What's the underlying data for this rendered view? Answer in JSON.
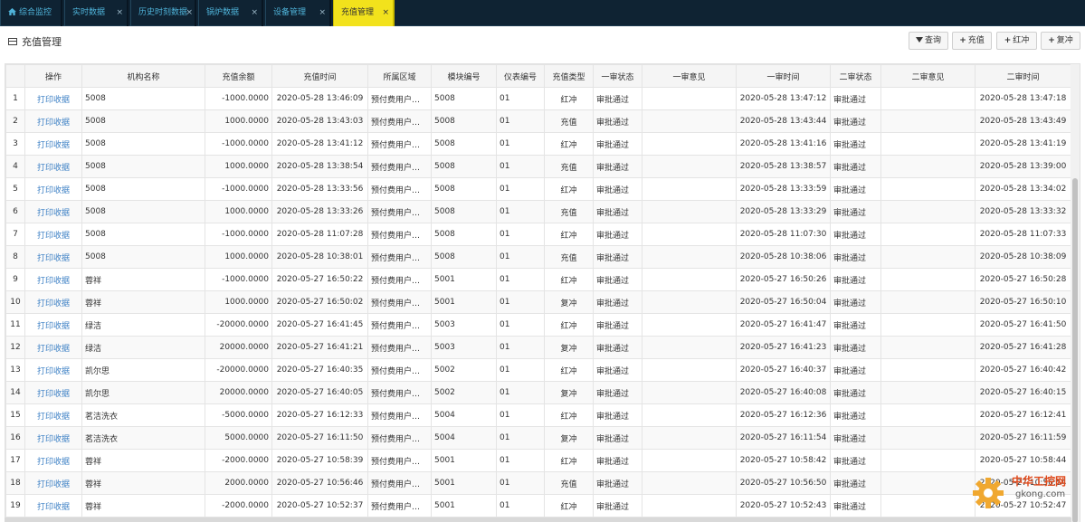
{
  "tabs": [
    {
      "label": "综合监控",
      "icon": "home-icon",
      "closable": false,
      "active": false
    },
    {
      "label": "实时数据",
      "closable": true,
      "active": false
    },
    {
      "label": "历史时刻数据",
      "closable": true,
      "active": false
    },
    {
      "label": "锅炉数据",
      "closable": true,
      "active": false
    },
    {
      "label": "设备管理",
      "closable": true,
      "active": false
    },
    {
      "label": "充值管理",
      "closable": true,
      "active": true
    }
  ],
  "close_glyph": "×",
  "colors": {
    "tab_bar": "#0f2333",
    "tab_text": "#4fb3d9",
    "active_tab": "#f2e21c",
    "link": "#3b7fc4"
  },
  "panel": {
    "title": "充值管理",
    "title_icon": "table-icon"
  },
  "toolbar": {
    "query": {
      "label": "查询",
      "icon": "filter-icon"
    },
    "recharge": {
      "label": "充值",
      "icon": "plus-icon"
    },
    "red_reversal": {
      "label": "红冲",
      "icon": "plus-icon"
    },
    "counter_reversal": {
      "label": "复冲",
      "icon": "plus-icon"
    }
  },
  "table": {
    "columns": [
      "",
      "操作",
      "机构名称",
      "充值余额",
      "充值时间",
      "所属区域",
      "模块编号",
      "仪表编号",
      "充值类型",
      "一审状态",
      "一审意见",
      "一审时间",
      "二审状态",
      "二审意见",
      "二审时间"
    ],
    "rows": [
      [
        "1",
        "打印收据",
        "5008",
        "-1000.0000",
        "2020-05-28 13:46:09",
        "预付费用户…",
        "5008",
        "01",
        "红冲",
        "审批通过",
        "",
        "2020-05-28 13:47:12",
        "审批通过",
        "",
        "2020-05-28 13:47:18"
      ],
      [
        "2",
        "打印收据",
        "5008",
        "1000.0000",
        "2020-05-28 13:43:03",
        "预付费用户…",
        "5008",
        "01",
        "充值",
        "审批通过",
        "",
        "2020-05-28 13:43:44",
        "审批通过",
        "",
        "2020-05-28 13:43:49"
      ],
      [
        "3",
        "打印收据",
        "5008",
        "-1000.0000",
        "2020-05-28 13:41:12",
        "预付费用户…",
        "5008",
        "01",
        "红冲",
        "审批通过",
        "",
        "2020-05-28 13:41:16",
        "审批通过",
        "",
        "2020-05-28 13:41:19"
      ],
      [
        "4",
        "打印收据",
        "5008",
        "1000.0000",
        "2020-05-28 13:38:54",
        "预付费用户…",
        "5008",
        "01",
        "充值",
        "审批通过",
        "",
        "2020-05-28 13:38:57",
        "审批通过",
        "",
        "2020-05-28 13:39:00"
      ],
      [
        "5",
        "打印收据",
        "5008",
        "-1000.0000",
        "2020-05-28 13:33:56",
        "预付费用户…",
        "5008",
        "01",
        "红冲",
        "审批通过",
        "",
        "2020-05-28 13:33:59",
        "审批通过",
        "",
        "2020-05-28 13:34:02"
      ],
      [
        "6",
        "打印收据",
        "5008",
        "1000.0000",
        "2020-05-28 13:33:26",
        "预付费用户…",
        "5008",
        "01",
        "充值",
        "审批通过",
        "",
        "2020-05-28 13:33:29",
        "审批通过",
        "",
        "2020-05-28 13:33:32"
      ],
      [
        "7",
        "打印收据",
        "5008",
        "-1000.0000",
        "2020-05-28 11:07:28",
        "预付费用户…",
        "5008",
        "01",
        "红冲",
        "审批通过",
        "",
        "2020-05-28 11:07:30",
        "审批通过",
        "",
        "2020-05-28 11:07:33"
      ],
      [
        "8",
        "打印收据",
        "5008",
        "1000.0000",
        "2020-05-28 10:38:01",
        "预付费用户…",
        "5008",
        "01",
        "充值",
        "审批通过",
        "",
        "2020-05-28 10:38:06",
        "审批通过",
        "",
        "2020-05-28 10:38:09"
      ],
      [
        "9",
        "打印收据",
        "蓉祥",
        "-1000.0000",
        "2020-05-27 16:50:22",
        "预付费用户…",
        "5001",
        "01",
        "红冲",
        "审批通过",
        "",
        "2020-05-27 16:50:26",
        "审批通过",
        "",
        "2020-05-27 16:50:28"
      ],
      [
        "10",
        "打印收据",
        "蓉祥",
        "1000.0000",
        "2020-05-27 16:50:02",
        "预付费用户…",
        "5001",
        "01",
        "复冲",
        "审批通过",
        "",
        "2020-05-27 16:50:04",
        "审批通过",
        "",
        "2020-05-27 16:50:10"
      ],
      [
        "11",
        "打印收据",
        "绿洁",
        "-20000.0000",
        "2020-05-27 16:41:45",
        "预付费用户…",
        "5003",
        "01",
        "红冲",
        "审批通过",
        "",
        "2020-05-27 16:41:47",
        "审批通过",
        "",
        "2020-05-27 16:41:50"
      ],
      [
        "12",
        "打印收据",
        "绿洁",
        "20000.0000",
        "2020-05-27 16:41:21",
        "预付费用户…",
        "5003",
        "01",
        "复冲",
        "审批通过",
        "",
        "2020-05-27 16:41:23",
        "审批通过",
        "",
        "2020-05-27 16:41:28"
      ],
      [
        "13",
        "打印收据",
        "凯尔思",
        "-20000.0000",
        "2020-05-27 16:40:35",
        "预付费用户…",
        "5002",
        "01",
        "红冲",
        "审批通过",
        "",
        "2020-05-27 16:40:37",
        "审批通过",
        "",
        "2020-05-27 16:40:42"
      ],
      [
        "14",
        "打印收据",
        "凯尔思",
        "20000.0000",
        "2020-05-27 16:40:05",
        "预付费用户…",
        "5002",
        "01",
        "复冲",
        "审批通过",
        "",
        "2020-05-27 16:40:08",
        "审批通过",
        "",
        "2020-05-27 16:40:15"
      ],
      [
        "15",
        "打印收据",
        "茗洁洗衣",
        "-5000.0000",
        "2020-05-27 16:12:33",
        "预付费用户…",
        "5004",
        "01",
        "红冲",
        "审批通过",
        "",
        "2020-05-27 16:12:36",
        "审批通过",
        "",
        "2020-05-27 16:12:41"
      ],
      [
        "16",
        "打印收据",
        "茗洁洗衣",
        "5000.0000",
        "2020-05-27 16:11:50",
        "预付费用户…",
        "5004",
        "01",
        "复冲",
        "审批通过",
        "",
        "2020-05-27 16:11:54",
        "审批通过",
        "",
        "2020-05-27 16:11:59"
      ],
      [
        "17",
        "打印收据",
        "蓉祥",
        "-2000.0000",
        "2020-05-27 10:58:39",
        "预付费用户…",
        "5001",
        "01",
        "红冲",
        "审批通过",
        "",
        "2020-05-27 10:58:42",
        "审批通过",
        "",
        "2020-05-27 10:58:44"
      ],
      [
        "18",
        "打印收据",
        "蓉祥",
        "2000.0000",
        "2020-05-27 10:56:46",
        "预付费用户…",
        "5001",
        "01",
        "充值",
        "审批通过",
        "",
        "2020-05-27 10:56:50",
        "审批通过",
        "",
        "2020-05-27 10:56:54"
      ],
      [
        "19",
        "打印收据",
        "蓉祥",
        "-2000.0000",
        "2020-05-27 10:52:37",
        "预付费用户…",
        "5001",
        "01",
        "红冲",
        "审批通过",
        "",
        "2020-05-27 10:52:43",
        "审批通过",
        "",
        "2020-05-27 10:52:47"
      ]
    ]
  },
  "watermark": {
    "title": "中华工控网",
    "url": "gkong.com"
  }
}
